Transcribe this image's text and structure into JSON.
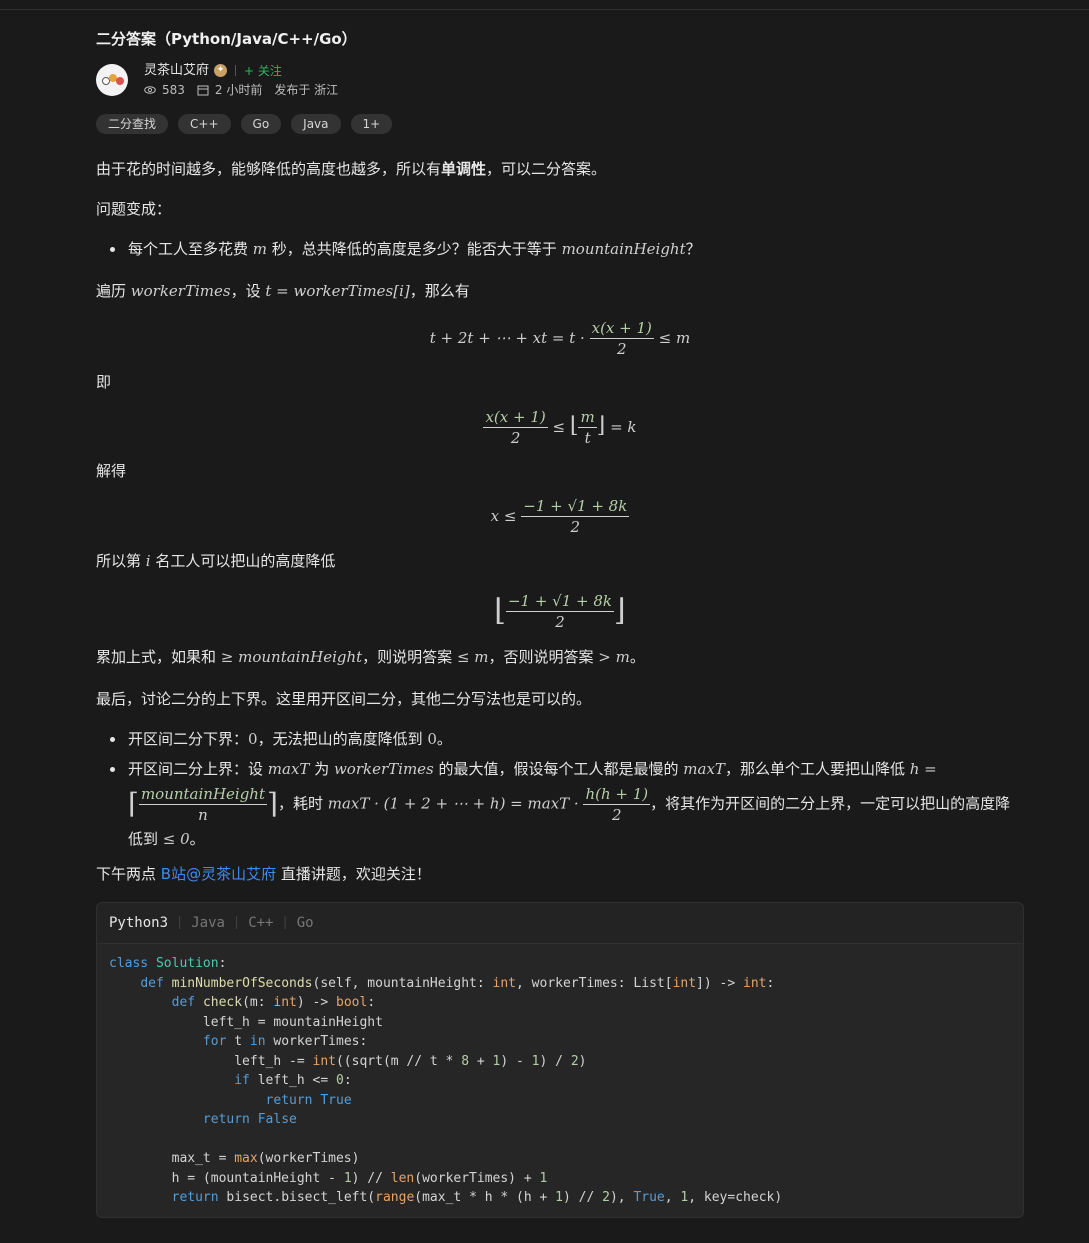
{
  "article": {
    "title": "二分答案（Python/Java/C++/Go）",
    "author": {
      "name": "灵茶山艾府",
      "follow_label": "+ 关注",
      "views": "583",
      "time": "2 小时前",
      "location": "发布于 浙江"
    },
    "tags": [
      "二分查找",
      "C++",
      "Go",
      "Java",
      "1+"
    ]
  },
  "body": {
    "p1_a": "由于花的时间越多，能够降低的高度也越多，所以有",
    "p1_b": "单调性",
    "p1_c": "，可以二分答案。",
    "p2": "问题变成：",
    "li1_a": "每个工人至多花费 ",
    "li1_m": "m",
    "li1_b": " 秒，总共降低的高度是多少？能否大于等于 ",
    "li1_mh": "mountainHeight",
    "li1_c": "？",
    "p3_a": "遍历 ",
    "p3_wt": "workerTimes",
    "p3_b": "，设 ",
    "p3_eq": "t = workerTimes[i]",
    "p3_c": "，那么有",
    "eq1_left": "t + 2t + ⋯ + xt = t ·",
    "eq1_num": "x(x + 1)",
    "eq1_den": "2",
    "eq1_right": "≤ m",
    "p4": "即",
    "eq2_num": "x(x + 1)",
    "eq2_den": "2",
    "eq2_mid": "≤",
    "eq2_fnum": "m",
    "eq2_fden": "t",
    "eq2_right": "= k",
    "p5": "解得",
    "eq3_left": "x ≤",
    "eq3_num": "−1 + √1 + 8k",
    "eq3_den": "2",
    "p6_a": "所以第 ",
    "p6_i": "i",
    "p6_b": " 名工人可以把山的高度降低",
    "eq4_num": "−1 + √1 + 8k",
    "eq4_den": "2",
    "p7_a": "累加上式，如果和 ",
    "p7_ge": "≥ mountainHeight",
    "p7_b": "，则说明答案 ",
    "p7_le": "≤ m",
    "p7_c": "，否则说明答案 ",
    "p7_gt": "> m",
    "p7_d": "。",
    "p8": "最后，讨论二分的上下界。这里用开区间二分，其他二分写法也是可以的。",
    "li2_a": "开区间二分下界：",
    "li2_z1": "0",
    "li2_b": "，无法把山的高度降低到 ",
    "li2_z2": "0",
    "li2_c": "。",
    "li3_a": "开区间二分上界：设 ",
    "li3_mt": "maxT",
    "li3_b": " 为 ",
    "li3_wt": "workerTimes",
    "li3_c": " 的最大值，假设每个工人都是最慢的 ",
    "li3_mt2": "maxT",
    "li3_d": "，那么单个工人要把山降低 ",
    "li3_h": "h =",
    "li3_fnum": "mountainHeight",
    "li3_fden": "n",
    "li3_e": "，耗时 ",
    "li3_expr": "maxT · (1 + 2 + ⋯ + h) = maxT ·",
    "li3_hnum": "h(h + 1)",
    "li3_hden": "2",
    "li3_f": "，将其作为开区间的二分上界，一定可以把山的高度降",
    "li3_g": "低到 ",
    "li3_le0": "≤ 0",
    "li3_h2": "。",
    "p9_a": "下午两点 ",
    "p9_link": "B站@灵茶山艾府",
    "p9_b": " 直播讲题，欢迎关注！"
  },
  "code": {
    "tabs": [
      "Python3",
      "Java",
      "C++",
      "Go"
    ],
    "active_tab": "Python3"
  }
}
